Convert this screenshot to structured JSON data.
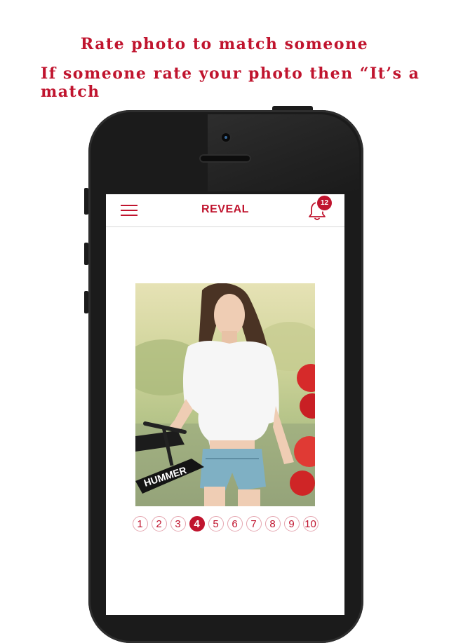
{
  "headline": {
    "line1": "Rate photo to match someone",
    "line2": "If someone rate your photo then “It’s a match"
  },
  "app": {
    "title": "REVEAL",
    "notifications_count": "12"
  },
  "rating": {
    "options": [
      "1",
      "2",
      "3",
      "4",
      "5",
      "6",
      "7",
      "8",
      "9",
      "10"
    ],
    "selected": 4
  },
  "colors": {
    "accent": "#c0142e",
    "phone_body": "#1b1b1b"
  },
  "icons": {
    "menu": "hamburger-icon",
    "notifications": "bell-icon"
  }
}
